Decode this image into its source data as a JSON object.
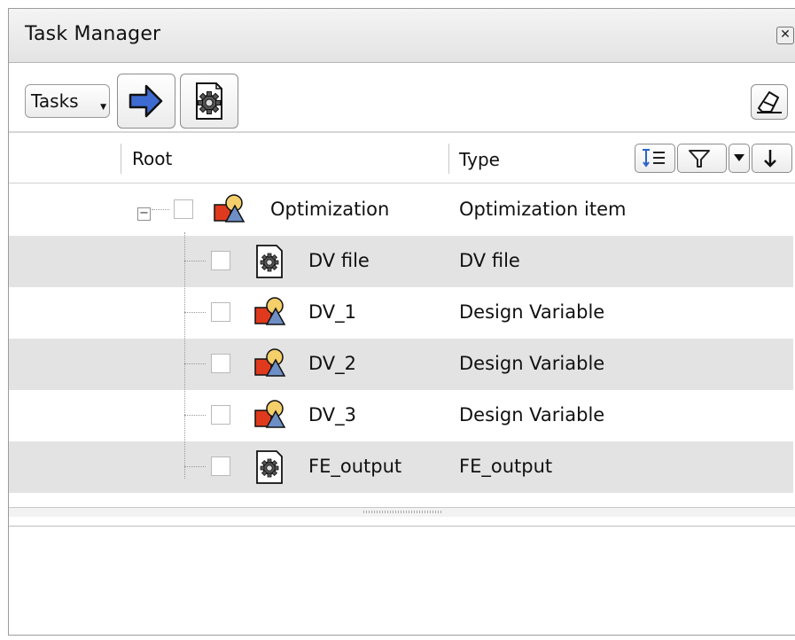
{
  "window": {
    "title": "Task Manager"
  },
  "toolbar": {
    "tasks_label": "Tasks"
  },
  "columns": {
    "root": "Root",
    "type": "Type"
  },
  "icons": {
    "close": "close-icon",
    "run": "arrow-right-icon",
    "gear": "gear-file-icon",
    "eraser": "eraser-icon",
    "sort": "sort-icon",
    "filter": "filter-icon",
    "dropdown": "dropdown-icon",
    "down_arrow": "arrow-down-icon",
    "shapes": "shapes-icon"
  },
  "colors": {
    "row_alt": "#e3e3e3",
    "accent_arrow": "#3d6bd1",
    "shape_red": "#e03a1e",
    "shape_blue": "#6d8fc6",
    "shape_yellow": "#f4cf6a"
  },
  "tree": {
    "root": {
      "name": "Optimization",
      "type": "Optimization item"
    },
    "children": [
      {
        "name": "DV file",
        "type": "DV file",
        "icon": "gear-file-icon"
      },
      {
        "name": "DV_1",
        "type": "Design Variable",
        "icon": "shapes-icon"
      },
      {
        "name": "DV_2",
        "type": "Design Variable",
        "icon": "shapes-icon"
      },
      {
        "name": "DV_3",
        "type": "Design Variable",
        "icon": "shapes-icon"
      },
      {
        "name": "FE_output",
        "type": "FE_output",
        "icon": "gear-file-icon"
      }
    ]
  }
}
